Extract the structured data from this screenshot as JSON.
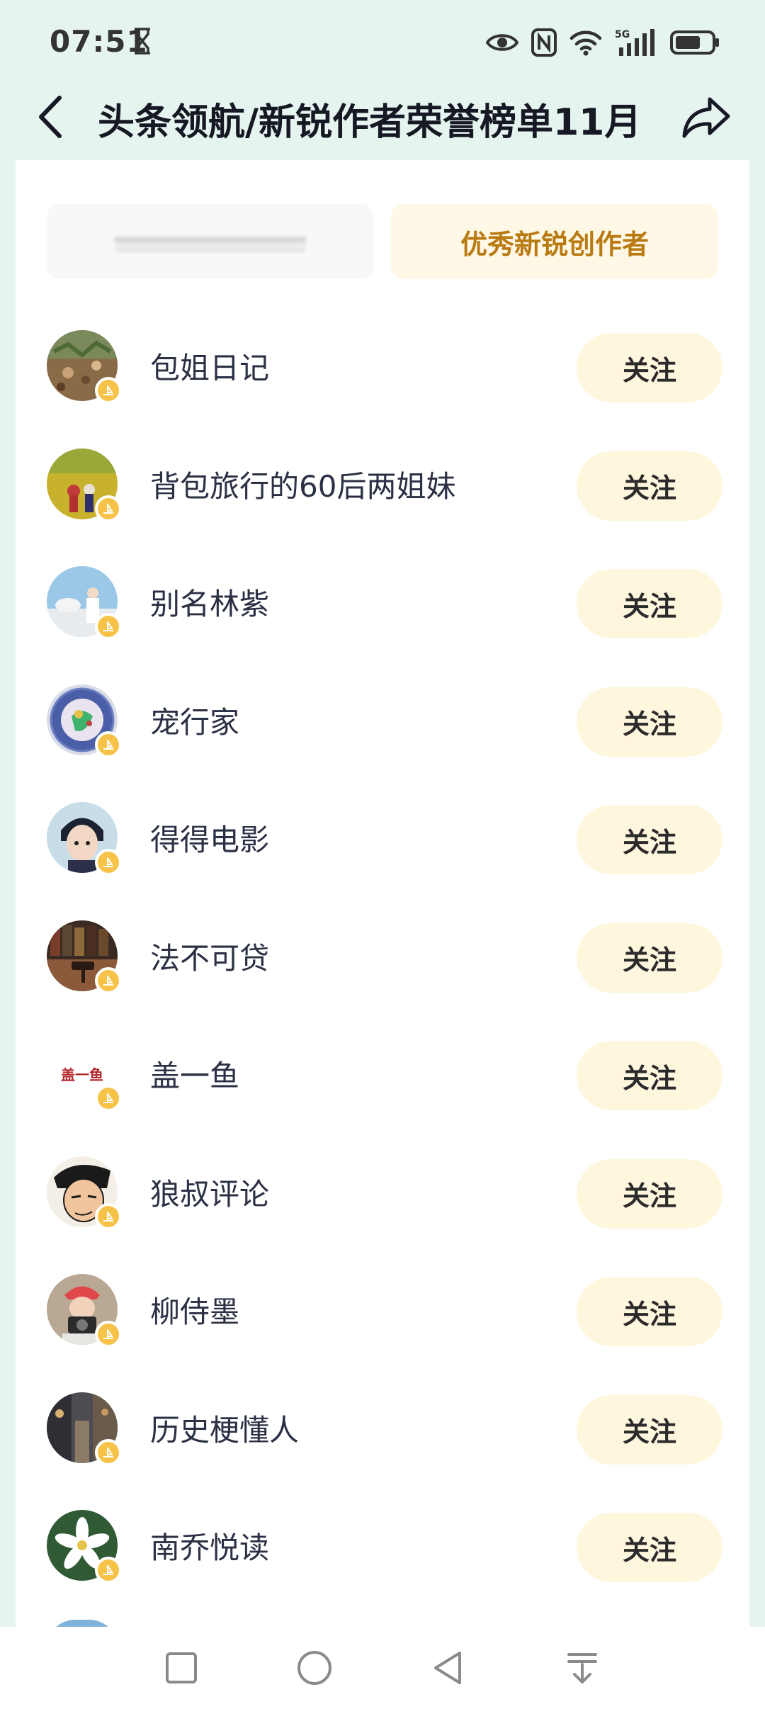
{
  "status_bar": {
    "time": "07:51",
    "icons": [
      "hourglass-icon",
      "eye-icon",
      "nfc-icon",
      "wifi-icon",
      "signal-5g-icon",
      "battery-icon"
    ]
  },
  "header": {
    "title": "头条领航/新锐作者荣誉榜单11月",
    "back_icon": "back-arrow-icon",
    "share_icon": "share-icon"
  },
  "tabs": {
    "active_label": "优秀新锐创作者"
  },
  "follow_label": "关注",
  "authors": [
    {
      "name": "包姐日记"
    },
    {
      "name": "背包旅行的60后两姐妹"
    },
    {
      "name": "别名林紫"
    },
    {
      "name": "宠行家"
    },
    {
      "name": "得得电影"
    },
    {
      "name": "法不可贷"
    },
    {
      "name": "盖一鱼",
      "avatar_text": "盖一鱼"
    },
    {
      "name": "狼叔评论"
    },
    {
      "name": "柳侍墨"
    },
    {
      "name": "历史梗懂人"
    },
    {
      "name": "南乔悦读"
    }
  ],
  "colors": {
    "background": "#e6f4f0",
    "accent_gold": "#b97a12",
    "follow_bg": "#fff6de",
    "badge": "#f6c248"
  },
  "nav": {
    "icons": [
      "square-recents-icon",
      "circle-home-icon",
      "triangle-back-icon",
      "arrow-down-notification-icon"
    ]
  }
}
